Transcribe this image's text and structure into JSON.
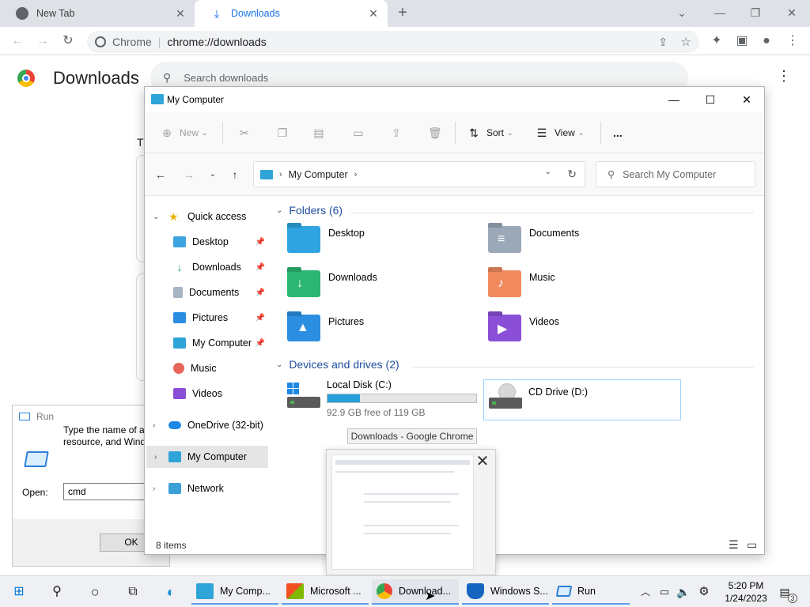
{
  "chrome": {
    "tabs": [
      {
        "title": "New Tab"
      },
      {
        "title": "Downloads"
      }
    ],
    "omnibox": {
      "site": "Chrome",
      "url": "chrome://downloads"
    },
    "page": {
      "title": "Downloads",
      "search_placeholder": "Search downloads",
      "partial_text": "T"
    }
  },
  "run_dialog": {
    "title": "Run",
    "description": "Type the name of a resource, and Wind",
    "open_label": "Open:",
    "input_value": "cmd",
    "ok_label": "OK"
  },
  "explorer": {
    "title": "My Computer",
    "toolbar": {
      "new": "New",
      "sort": "Sort",
      "view": "View",
      "more": "..."
    },
    "address": {
      "location": "My Computer"
    },
    "search_placeholder": "Search My Computer",
    "nav": {
      "quick_access": "Quick access",
      "items": [
        "Desktop",
        "Downloads",
        "Documents",
        "Pictures",
        "My Computer",
        "Music",
        "Videos"
      ],
      "onedrive": "OneDrive (32-bit)",
      "my_computer": "My Computer",
      "network": "Network"
    },
    "folders_header": "Folders (6)",
    "folders": [
      "Desktop",
      "Documents",
      "Downloads",
      "Music",
      "Pictures",
      "Videos"
    ],
    "drives_header": "Devices and drives (2)",
    "drives": [
      {
        "name": "Local Disk (C:)",
        "free": "92.9 GB free of 119 GB",
        "used_fraction": 0.22
      },
      {
        "name": "CD Drive (D:)"
      }
    ],
    "status": "8 items"
  },
  "taskbar_preview": {
    "tooltip": "Downloads - Google Chrome"
  },
  "taskbar": {
    "apps": [
      "My Comp...",
      "Microsoft ...",
      "Download...",
      "Windows S...",
      "Run"
    ],
    "time": "5:20 PM",
    "date": "1/24/2023",
    "notifications": "3"
  },
  "colors": {
    "accent": "#1a73e8",
    "drive_fill": "#26a0da"
  }
}
